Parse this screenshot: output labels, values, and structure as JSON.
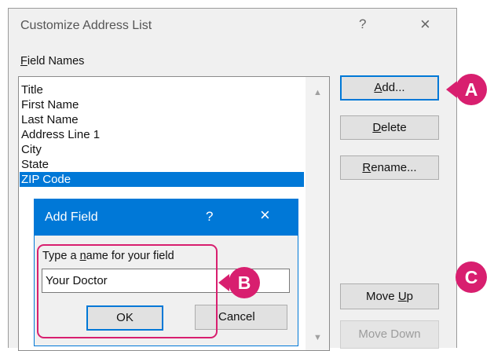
{
  "dialog": {
    "title": "Customize Address List",
    "help": "?",
    "close": "×"
  },
  "fields": {
    "label_prefix": "",
    "label_u": "F",
    "label_rest": "ield Names",
    "items": [
      "Title",
      "First Name",
      "Last Name",
      "Address Line 1",
      "City",
      "State",
      "ZIP Code"
    ],
    "selected_index": 6
  },
  "buttons": {
    "add": {
      "pre": "",
      "u": "A",
      "post": "dd..."
    },
    "delete": {
      "pre": "",
      "u": "D",
      "post": "elete"
    },
    "rename": {
      "pre": "",
      "u": "R",
      "post": "ename..."
    },
    "move_up": {
      "pre": "Move ",
      "u": "U",
      "post": "p"
    },
    "move_down": {
      "label": "Move Down"
    }
  },
  "add_field": {
    "title": "Add Field",
    "help": "?",
    "close": "×",
    "prompt_pre": "Type a ",
    "prompt_u": "n",
    "prompt_post": "ame for your field",
    "value": "Your Doctor",
    "ok": "OK",
    "cancel": "Cancel"
  },
  "callouts": {
    "a": "A",
    "b": "B",
    "c": "C"
  },
  "colors": {
    "accent": "#0078d7",
    "callout": "#d81f6f"
  }
}
